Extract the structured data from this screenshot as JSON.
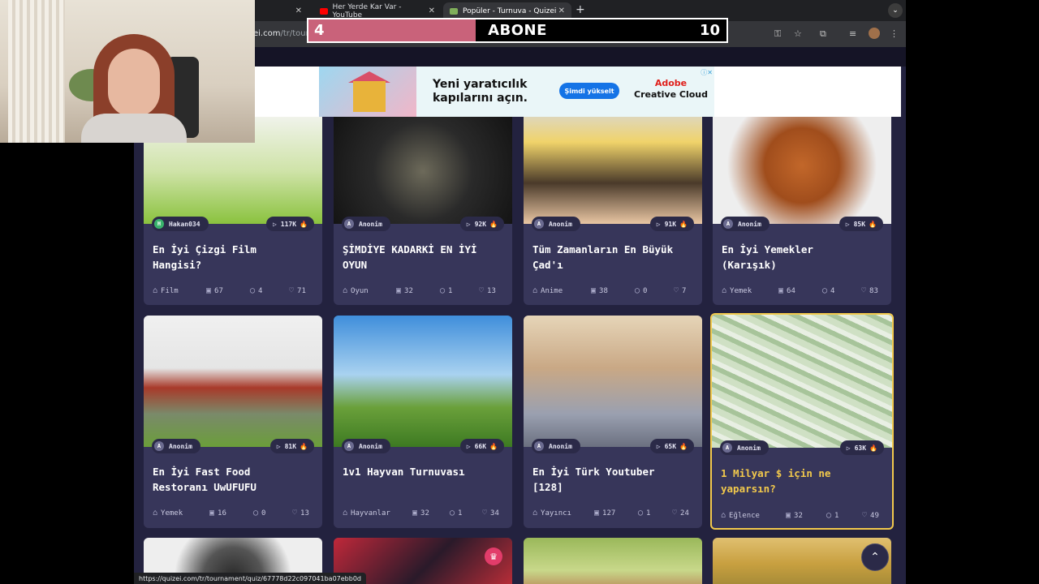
{
  "browser": {
    "tabs": [
      {
        "title": "Her Yerde Kar Var - YouTube",
        "favicon_color": "#ff0000",
        "active": false
      },
      {
        "title": "Popüler - Turnuva - Quizei",
        "favicon_color": "#7fae5a",
        "active": true
      }
    ],
    "url_prefix": "ei.com",
    "url_path": "/tr/tourn",
    "status_url": "https://quizei.com/tr/tournament/quiz/67778d22c097041ba07ebb0d"
  },
  "sub_banner": {
    "current": "4",
    "label": "ABONE",
    "goal": "10",
    "fill_fraction": 0.4,
    "fill_color": "#c9627a"
  },
  "ad": {
    "headline_1": "Yeni yaratıcılık",
    "headline_2": "kapılarını açın.",
    "cta": "Şimdi yükselt",
    "brand_1": "Adobe",
    "brand_2": "Creative Cloud"
  },
  "cards": [
    {
      "author": "Hakan034",
      "author_initial": "H",
      "plays": "117K",
      "title_1": "En İyi Çizgi Film",
      "title_2": "Hangisi?",
      "category": "Film",
      "images": "67",
      "comments": "4",
      "likes": "71"
    },
    {
      "author": "Anonim",
      "author_initial": "A",
      "plays": "92K",
      "title_1": "ŞİMDİYE KADARKİ EN İYİ",
      "title_2": "OYUN",
      "category": "Oyun",
      "images": "32",
      "comments": "1",
      "likes": "13"
    },
    {
      "author": "Anonim",
      "author_initial": "A",
      "plays": "91K",
      "title_1": "Tüm Zamanların En Büyük",
      "title_2": "Çad'ı",
      "category": "Anime",
      "images": "38",
      "comments": "0",
      "likes": "7"
    },
    {
      "author": "Anonim",
      "author_initial": "A",
      "plays": "85K",
      "title_1": "En İyi Yemekler",
      "title_2": "(Karışık)",
      "category": "Yemek",
      "images": "64",
      "comments": "4",
      "likes": "83"
    },
    {
      "author": "Anonim",
      "author_initial": "A",
      "plays": "81K",
      "title_1": "En İyi Fast Food",
      "title_2": "Restoranı UwUFUFU",
      "category": "Yemek",
      "images": "16",
      "comments": "0",
      "likes": "13"
    },
    {
      "author": "Anonim",
      "author_initial": "A",
      "plays": "66K",
      "title_1": "1v1 Hayvan Turnuvası",
      "title_2": "",
      "category": "Hayvanlar",
      "images": "32",
      "comments": "1",
      "likes": "34"
    },
    {
      "author": "Anonim",
      "author_initial": "A",
      "plays": "65K",
      "title_1": "En İyi Türk Youtuber",
      "title_2": "[128]",
      "category": "Yayıncı",
      "images": "127",
      "comments": "1",
      "likes": "24"
    },
    {
      "author": "Anonim",
      "author_initial": "A",
      "plays": "63K",
      "title_1": "1 Milyar $ için ne",
      "title_2": "yaparsın?",
      "category": "Eğlence",
      "images": "32",
      "comments": "1",
      "likes": "49"
    }
  ]
}
